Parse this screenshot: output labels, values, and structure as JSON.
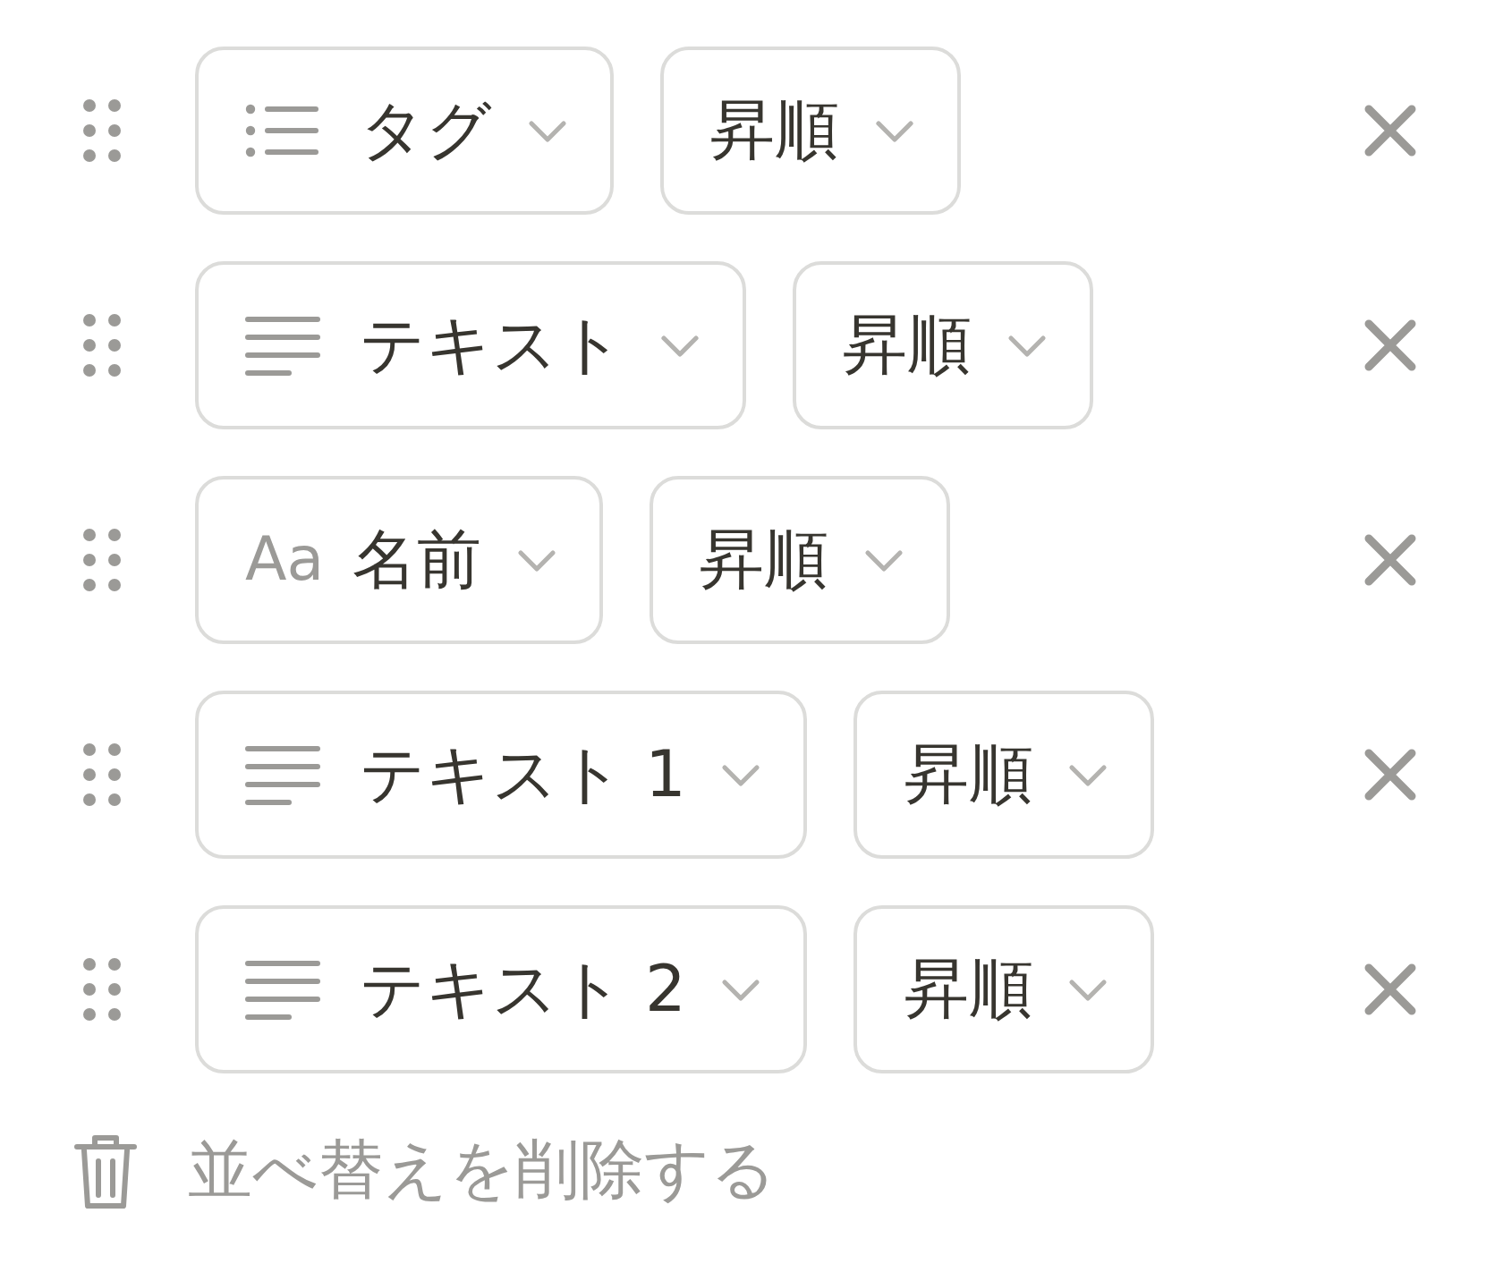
{
  "sorts": [
    {
      "property": {
        "kind": "multi_select",
        "label": "タグ"
      },
      "direction": "昇順"
    },
    {
      "property": {
        "kind": "text",
        "label": "テキスト"
      },
      "direction": "昇順"
    },
    {
      "property": {
        "kind": "title",
        "icon_text": "Aa",
        "label": "名前"
      },
      "direction": "昇順"
    },
    {
      "property": {
        "kind": "text",
        "label": "テキスト 1"
      },
      "direction": "昇順"
    },
    {
      "property": {
        "kind": "text",
        "label": "テキスト 2"
      },
      "direction": "昇順"
    }
  ],
  "delete_action": {
    "label": "並べ替えを削除する"
  }
}
